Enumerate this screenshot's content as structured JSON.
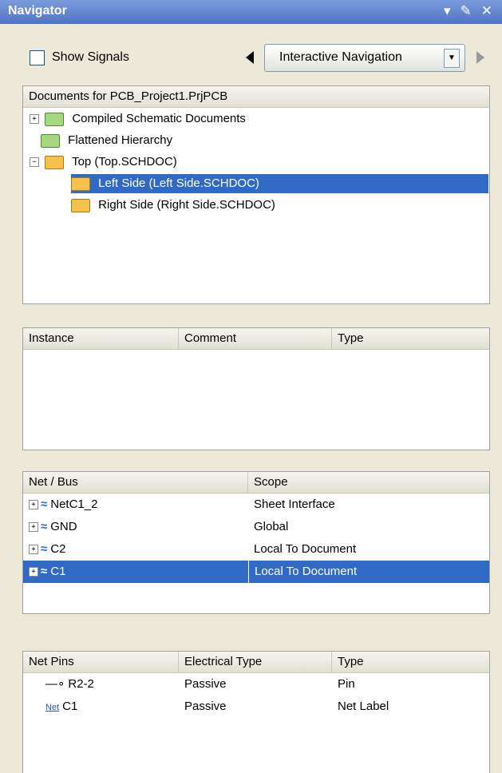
{
  "window": {
    "title": "Navigator",
    "icons": [
      "dropdown-arrow-icon",
      "pin-icon",
      "close-icon"
    ]
  },
  "toolbar": {
    "show_signals_label": "Show Signals",
    "show_signals_checked": false,
    "navigation_mode": "Interactive Navigation"
  },
  "documents": {
    "header": "Documents for PCB_Project1.PrjPCB",
    "items": [
      {
        "label": "Compiled  Schematic Documents",
        "icon": "folder-icon",
        "expandable": true
      },
      {
        "label": "Flattened Hierarchy",
        "icon": "folder-icon",
        "expandable": false
      },
      {
        "label": "Top (Top.SCHDOC)",
        "icon": "sheet-icon",
        "expandable": true,
        "expanded": true
      },
      {
        "label": "Left Side (Left Side.SCHDOC)",
        "icon": "sheet-icon",
        "selected": true
      },
      {
        "label": "Right Side (Right Side.SCHDOC)",
        "icon": "sheet-icon"
      }
    ]
  },
  "instances": {
    "columns": [
      "Instance",
      "Comment",
      "Type"
    ],
    "rows": []
  },
  "nets": {
    "columns": [
      "Net / Bus",
      "Scope"
    ],
    "rows": [
      {
        "name": "NetC1_2",
        "scope": "Sheet Interface"
      },
      {
        "name": "GND",
        "scope": "Global"
      },
      {
        "name": "C2",
        "scope": "Local To Document"
      },
      {
        "name": "C1",
        "scope": "Local To Document",
        "selected": true
      }
    ]
  },
  "net_pins": {
    "columns": [
      "Net Pins",
      "Electrical Type",
      "Type"
    ],
    "rows": [
      {
        "name": "R2-2",
        "icon": "pin-icon",
        "electrical_type": "Passive",
        "type": "Pin"
      },
      {
        "name": "C1",
        "icon": "net-label-icon",
        "electrical_type": "Passive",
        "type": "Net Label"
      }
    ]
  },
  "colors": {
    "selection": "#316AC5",
    "titlebar": "#5A7EDC",
    "panel_bg": "#ECE9D8"
  }
}
